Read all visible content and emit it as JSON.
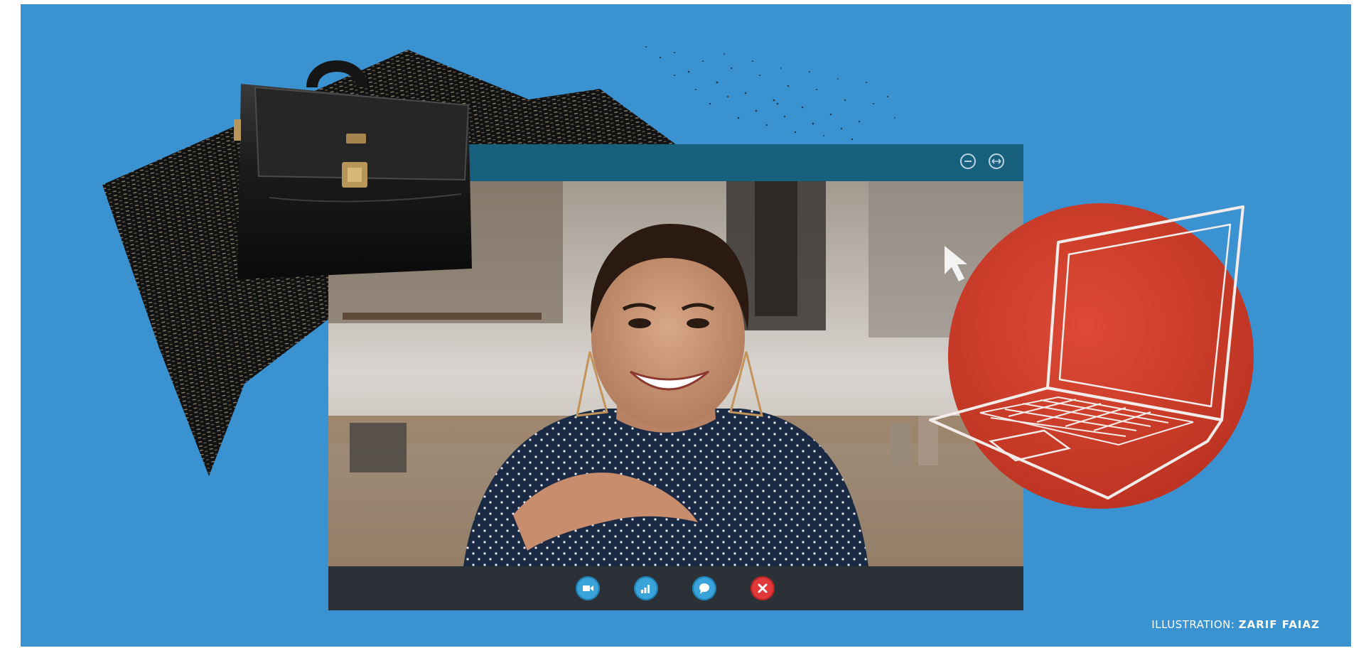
{
  "credit": {
    "prefix": "ILLUSTRATION: ",
    "name": "ZARIF FAIAZ"
  },
  "call_window": {
    "title_buttons": [
      "minimize-icon",
      "expand-icon"
    ],
    "controls": [
      {
        "icon": "video-camera-icon",
        "color": "#3aa3da"
      },
      {
        "icon": "signal-bars-icon",
        "color": "#3aa3da"
      },
      {
        "icon": "chat-bubble-icon",
        "color": "#3aa3da"
      },
      {
        "icon": "close-icon",
        "color": "#e2383a"
      }
    ]
  },
  "colors": {
    "background": "#3b92d1",
    "titlebar": "#17607e",
    "controlbar": "#2b3136",
    "accent_red": "#d9402e"
  }
}
